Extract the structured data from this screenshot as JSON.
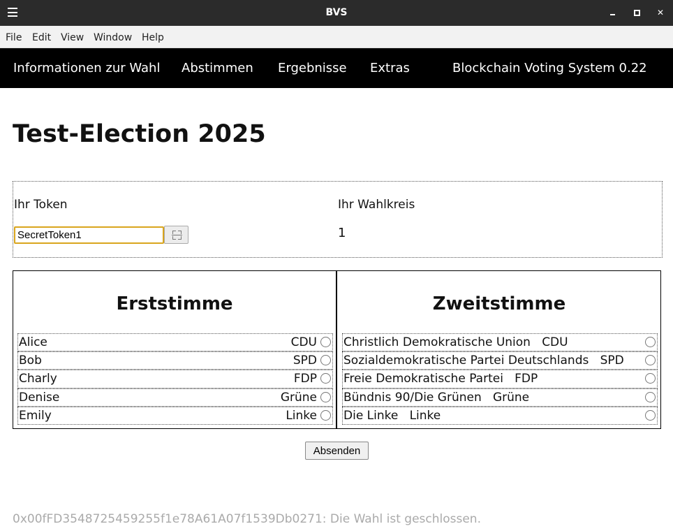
{
  "window": {
    "title": "BVS",
    "menu_icon": "hamburger-icon",
    "controls": [
      "minimize-icon",
      "maximize-icon",
      "close-icon"
    ]
  },
  "menubar": {
    "items": [
      "File",
      "Edit",
      "View",
      "Window",
      "Help"
    ]
  },
  "appnav": {
    "items": [
      "Informationen zur Wahl",
      "Abstimmen",
      "Ergebnisse",
      "Extras"
    ],
    "version": "Blockchain Voting System 0.22"
  },
  "election": {
    "title": "Test-Election 2025"
  },
  "token": {
    "label": "Ihr Token",
    "value": "SecretToken1",
    "scan_icon": "qr-scan-icon"
  },
  "wahlkreis": {
    "label": "Ihr Wahlkreis",
    "value": "1"
  },
  "erststimme": {
    "heading": "Erststimme",
    "candidates": [
      {
        "name": "Alice",
        "party": "CDU"
      },
      {
        "name": "Bob",
        "party": "SPD"
      },
      {
        "name": "Charly",
        "party": "FDP"
      },
      {
        "name": "Denise",
        "party": "Grüne"
      },
      {
        "name": "Emily",
        "party": "Linke"
      }
    ]
  },
  "zweitstimme": {
    "heading": "Zweitstimme",
    "parties": [
      {
        "name": "Christlich Demokratische Union",
        "short": "CDU"
      },
      {
        "name": "Sozialdemokratische Partei Deutschlands",
        "short": "SPD"
      },
      {
        "name": "Freie Demokratische Partei",
        "short": "FDP"
      },
      {
        "name": "Bündnis 90/Die Grünen",
        "short": "Grüne"
      },
      {
        "name": "Die Linke",
        "short": "Linke"
      }
    ]
  },
  "submit_label": "Absenden",
  "status": "0x00fFD3548725459255f1e78A61A07f1539Db0271: Die Wahl ist geschlossen.",
  "colors": {
    "titlebar": "#2b2b2b",
    "appnav": "#000000",
    "input_focus": "#d9a51d",
    "status_text": "#aaaaaa"
  }
}
